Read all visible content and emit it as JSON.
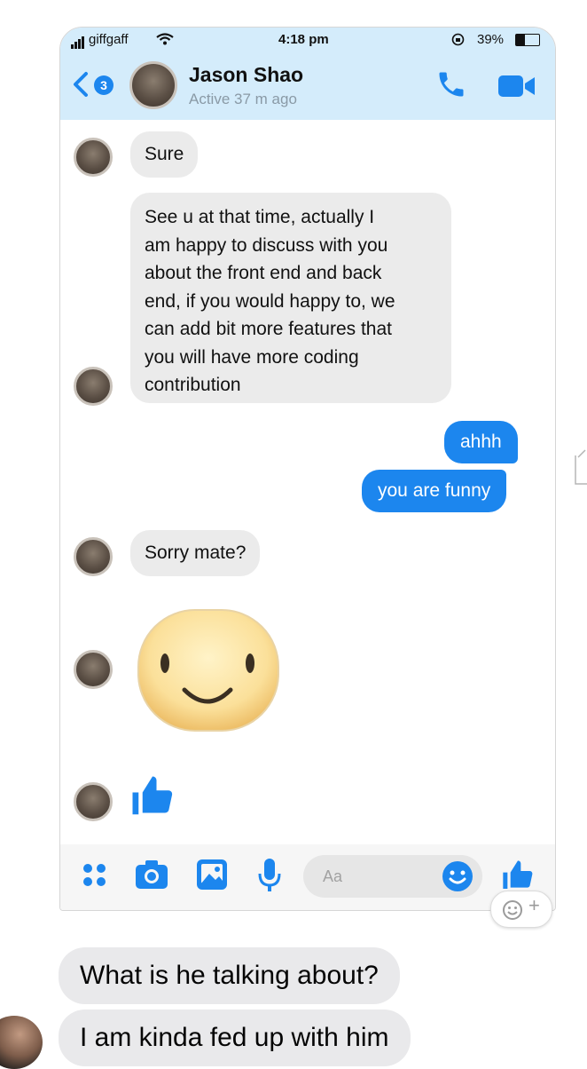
{
  "status_bar": {
    "carrier": "giffgaff",
    "time": "4:18 pm",
    "battery": "39%"
  },
  "conversation": {
    "back_badge": "3",
    "contact_name": "Jason Shao",
    "active_status": "Active 37 m ago"
  },
  "messages": [
    {
      "from": "them",
      "text": "Sure"
    },
    {
      "from": "them",
      "lines": [
        "See u at that time, actually I",
        "am happy to discuss with you",
        "about the front end and back",
        "end, if you would happy to, we",
        "can add bit more features that",
        "you will have more coding",
        "contribution"
      ]
    },
    {
      "from": "me",
      "text": "ahhh"
    },
    {
      "from": "me",
      "text": "you are funny"
    },
    {
      "from": "them",
      "text": "Sorry mate?"
    }
  ],
  "composer": {
    "placeholder": "Aa"
  },
  "outer_chat": [
    {
      "text": "What is he talking about?"
    },
    {
      "text": "I am kinda fed up with him"
    }
  ],
  "colors": {
    "accent": "#1c86ee",
    "header_bg": "#d4ecfb",
    "bubble_in": "#ebebeb"
  },
  "icons": [
    "back-chevron-icon",
    "phone-icon",
    "video-camera-icon",
    "thumbs-up-icon",
    "smile-sticker",
    "menu-dots-icon",
    "camera-icon",
    "photo-icon",
    "microphone-icon",
    "emoji-icon",
    "add-reaction-icon"
  ]
}
